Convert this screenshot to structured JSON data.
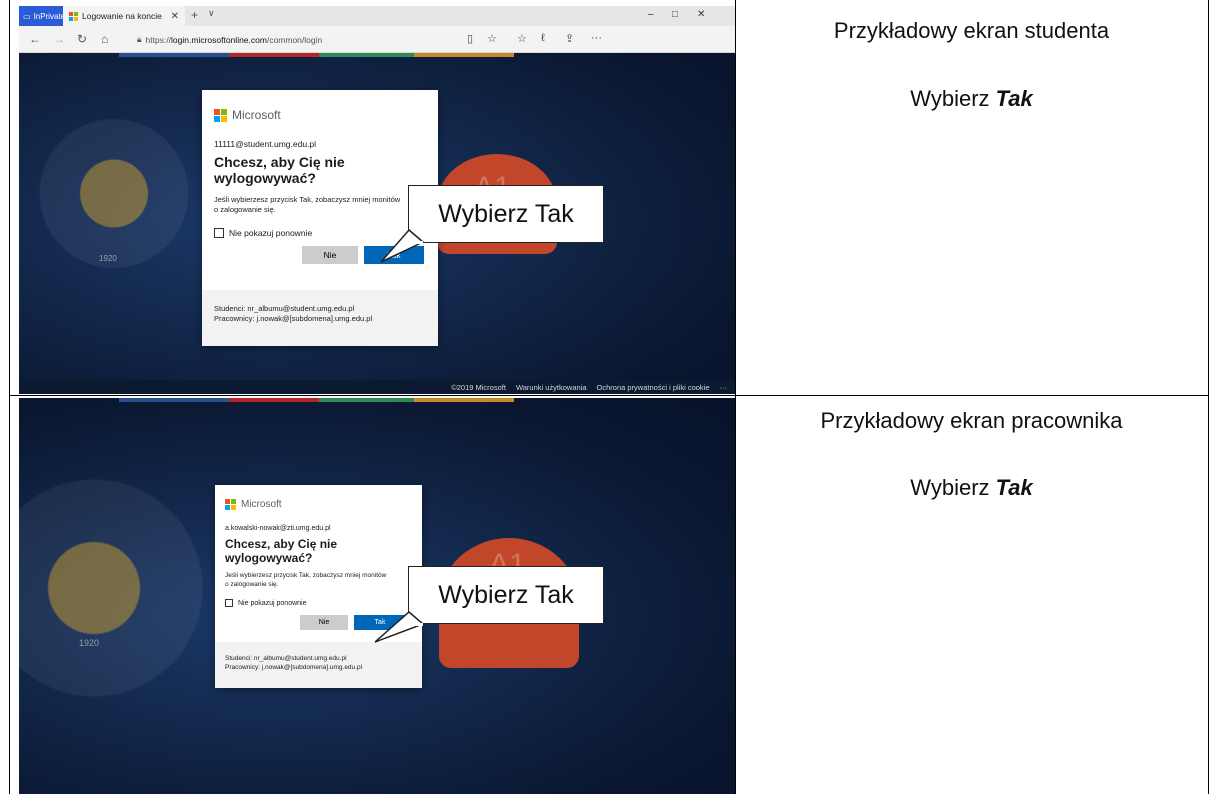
{
  "browser": {
    "inprivate_label": "InPrivate",
    "tab_title": "Logowanie na koncie",
    "url_prefix": "https://",
    "url_host": "login.microsoftonline.com",
    "url_path": "/common/login"
  },
  "dialog_student": {
    "brand": "Microsoft",
    "email": "11111@student.umg.edu.pl",
    "heading": "Chcesz, aby Cię nie wylogowywać?",
    "description": "Jeśli wybierzesz przycisk Tak, zobaczysz mniej monitów o zalogowanie się.",
    "checkbox_label": "Nie pokazuj ponownie",
    "no_button": "Nie",
    "yes_button": "Tak",
    "footer_line1": "Studenci: nr_albumu@student.umg.edu.pl",
    "footer_line2": "Pracownicy: j.nowak@[subdomena].umg.edu.pl"
  },
  "dialog_employee": {
    "brand": "Microsoft",
    "email": "a.kowalski-nowak@zti.umg.edu.pl",
    "heading": "Chcesz, aby Cię nie wylogowywać?",
    "description": "Jeśli wybierzesz przycisk Tak, zobaczysz mniej monitów o zalogowanie się.",
    "checkbox_label": "Nie pokazuj ponownie",
    "no_button": "Nie",
    "yes_button": "Tak",
    "footer_line1": "Studenci: nr_albumu@student.umg.edu.pl",
    "footer_line2": "Pracownicy: j.nowak@[subdomena].umg.edu.pl"
  },
  "callout_text": "Wybierz Tak",
  "statusbar": {
    "copyright": "©2019 Microsoft",
    "terms": "Warunki użytkowania",
    "privacy": "Ochrona prywatności i pliki cookie",
    "more": "···"
  },
  "seal": {
    "year": "1920",
    "cloud_text": "A1"
  },
  "instructions": {
    "student_title": "Przykładowy ekran studenta",
    "employee_title": "Przykładowy ekran pracownika",
    "choose_prefix": "Wybierz ",
    "choose_word": "Tak"
  },
  "colors": {
    "ms_red": "#f25022",
    "ms_green": "#7fba00",
    "ms_blue": "#00a4ef",
    "ms_yellow": "#ffb900",
    "button_blue": "#0067b8"
  }
}
